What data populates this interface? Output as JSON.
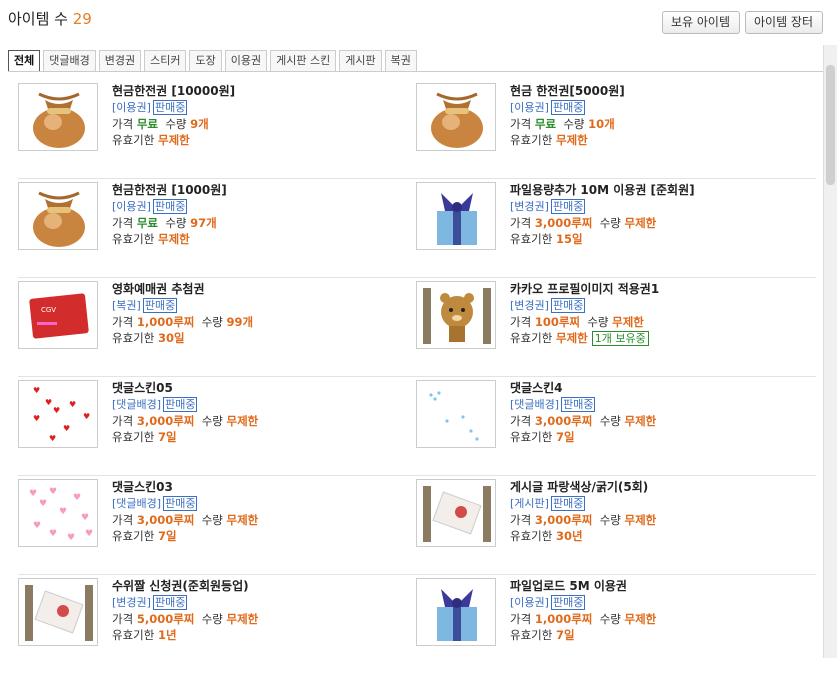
{
  "header": {
    "title": "아이템 수",
    "count": "29"
  },
  "buttons": {
    "owned": "보유 아이템",
    "market": "아이템 장터"
  },
  "tabs": [
    "전체",
    "댓글배경",
    "변경권",
    "스티커",
    "도장",
    "이용권",
    "게시판 스킨",
    "게시판",
    "복권"
  ],
  "labels": {
    "price": "가격",
    "qty": "수량",
    "expiry": "유효기한"
  },
  "items": [
    {
      "name": "현금한전권 [10000원]",
      "category": "[이용권]",
      "status": "판매중",
      "price": "무료",
      "qty": "9개",
      "expiry": "무제한",
      "icon": "money-bag-icon",
      "priceColor": "green"
    },
    {
      "name": "현금 한전권[5000원]",
      "category": "[이용권]",
      "status": "판매중",
      "price": "무료",
      "qty": "10개",
      "expiry": "무제한",
      "icon": "money-bag-icon",
      "priceColor": "green"
    },
    {
      "name": "현금한전권 [1000원]",
      "category": "[이용권]",
      "status": "판매중",
      "price": "무료",
      "qty": "97개",
      "expiry": "무제한",
      "icon": "money-bag-icon",
      "priceColor": "green"
    },
    {
      "name": "파일용량추가 10M 이용권 [준회원]",
      "category": "[변경권]",
      "status": "판매중",
      "price": "3,000루찌",
      "qty": "무제한",
      "expiry": "15일",
      "icon": "gift-box-icon",
      "priceColor": "orange"
    },
    {
      "name": "영화예매권 추첨권",
      "category": "[복권]",
      "status": "판매중",
      "price": "1,000루찌",
      "qty": "99개",
      "expiry": "30일",
      "icon": "ticket-icon",
      "priceColor": "orange"
    },
    {
      "name": "카카오 프로필이미지 적용권1",
      "category": "[변경권]",
      "status": "판매중",
      "price": "100루찌",
      "qty": "무제한",
      "expiry": "무제한",
      "icon": "bear-icon",
      "priceColor": "orange",
      "owned": "1개 보유중"
    },
    {
      "name": "댓글스킨05",
      "category": "[댓글배경]",
      "status": "판매중",
      "price": "3,000루찌",
      "qty": "무제한",
      "expiry": "7일",
      "icon": "hearts-icon",
      "priceColor": "orange"
    },
    {
      "name": "댓글스킨4",
      "category": "[댓글배경]",
      "status": "판매중",
      "price": "3,000루찌",
      "qty": "무제한",
      "expiry": "7일",
      "icon": "dots-icon",
      "priceColor": "orange"
    },
    {
      "name": "댓글스킨03",
      "category": "[댓글배경]",
      "status": "판매중",
      "price": "3,000루찌",
      "qty": "무제한",
      "expiry": "7일",
      "icon": "pink-hearts-icon",
      "priceColor": "orange"
    },
    {
      "name": "게시글 파랑색상/굵기(5회)",
      "category": "[게시판]",
      "status": "판매중",
      "price": "3,000루찌",
      "qty": "무제한",
      "expiry": "30년",
      "icon": "letter-icon",
      "priceColor": "orange"
    },
    {
      "name": "수위짤 신청권(준회원등업)",
      "category": "[변경권]",
      "status": "판매중",
      "price": "5,000루찌",
      "qty": "무제한",
      "expiry": "1년",
      "icon": "letter-icon",
      "priceColor": "orange"
    },
    {
      "name": "파일업로드 5M 이용권",
      "category": "[이용권]",
      "status": "판매중",
      "price": "1,000루찌",
      "qty": "무제한",
      "expiry": "7일",
      "icon": "gift-box-icon",
      "priceColor": "orange"
    }
  ]
}
